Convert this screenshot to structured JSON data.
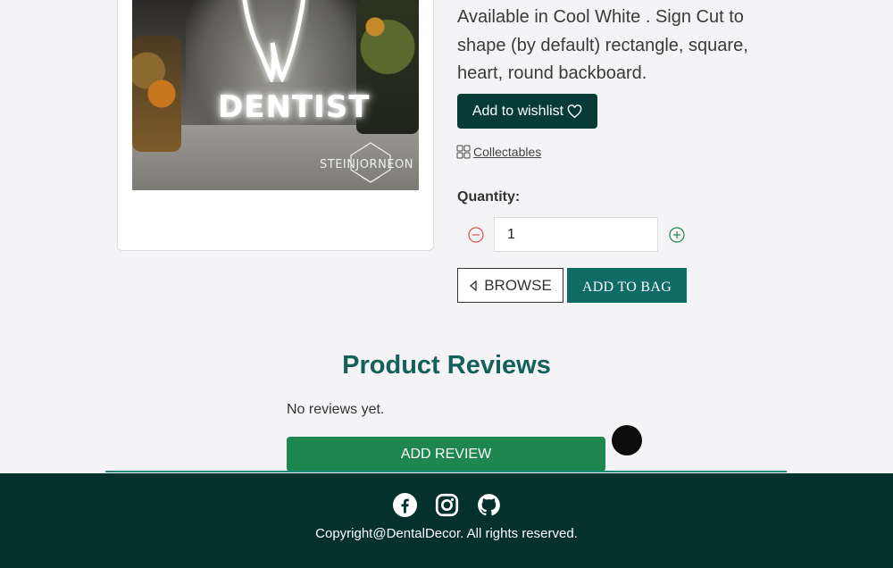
{
  "product": {
    "image": {
      "neon_text": "DENTIST",
      "watermark": "STEINJORNEON"
    },
    "description": "Available in Cool White . Sign Cut to shape (by default) rectangle, square, heart, round backboard.",
    "wishlist_label": "Add to wishlist",
    "category": "Collectables",
    "quantity_label": "Quantity:",
    "quantity_value": "1",
    "browse_label": "BROWSE",
    "add_to_bag_label": "ADD TO BAG"
  },
  "reviews": {
    "title": "Product Reviews",
    "empty_text": "No reviews yet.",
    "add_review_label": "ADD REVIEW"
  },
  "footer": {
    "social_icons": [
      "facebook-icon",
      "instagram-icon",
      "github-icon"
    ],
    "copyright": "Copyright@DentalDecor. All rights reserved."
  },
  "colors": {
    "primary_dark": "#063b38",
    "teal": "#0f6b65",
    "heading": "#14615c",
    "review_button": "#1e8750",
    "footer_bg": "#04302e"
  }
}
